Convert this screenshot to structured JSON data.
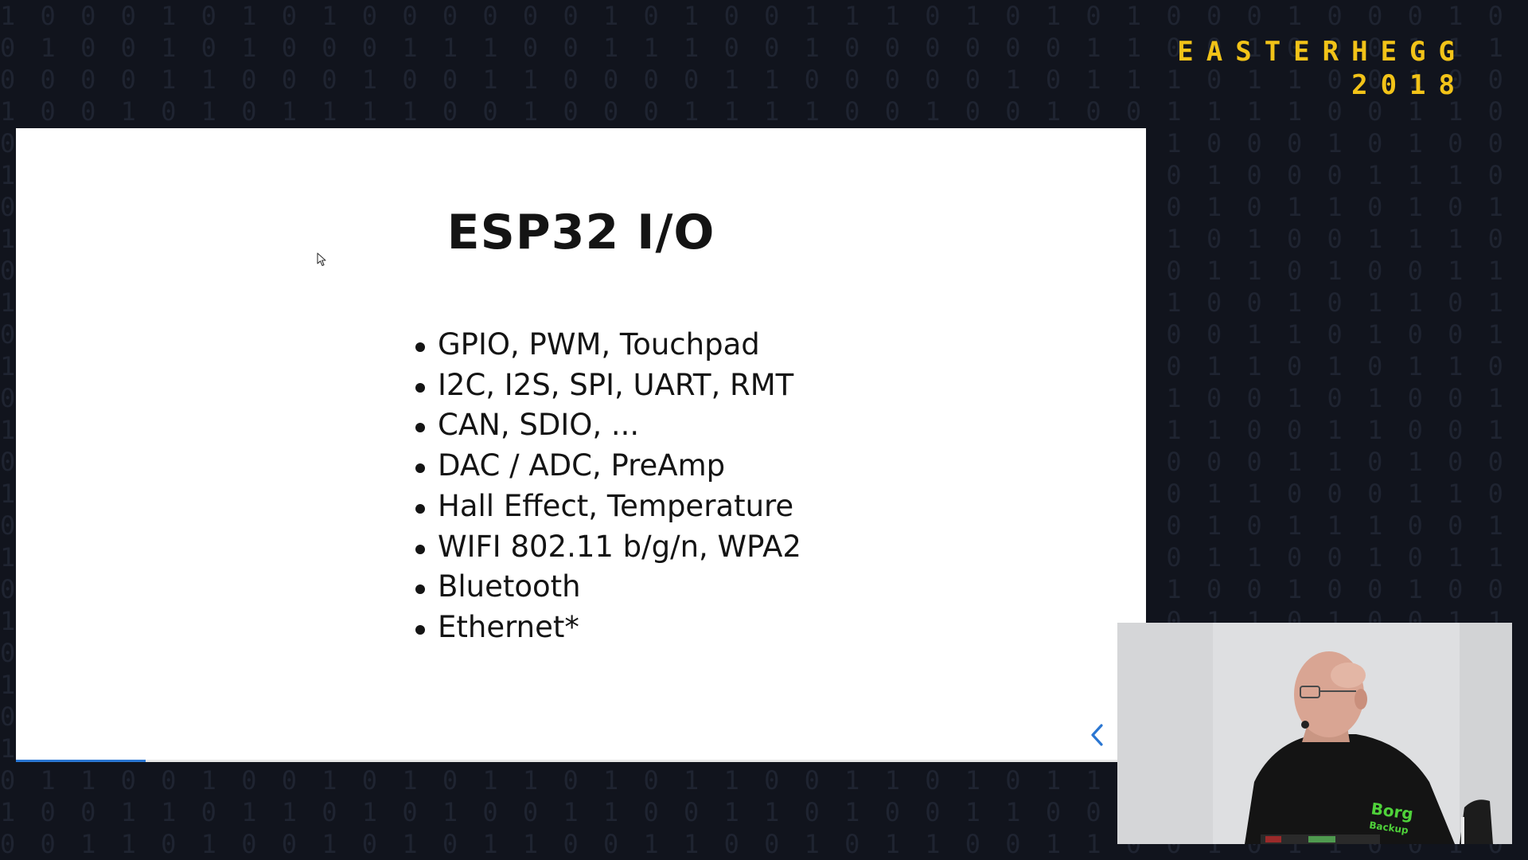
{
  "event": {
    "name": "EASTERHEGG",
    "year": "2018",
    "accent_color": "#f2c318"
  },
  "background": {
    "pattern": "binary digits",
    "rows": [
      "1 0 0 0 1 0 1 0 1 0 0 0 0 0 0 1 0 1 0 0 1 1 1 0 1 0 1 0 1 0 0 0 1 0 0 0 1 0 1 0 1 0 1 0 0 0 1 1 0 1",
      "0 1 0 0 1 0 1 0 0 0 1 1 1 0 0 1 1 1 0 0 1 0 0 0 0 0 0 1 1 0 0 1 0 0 0 1 1 1 0 1 0 1 1 0 0 1 0 0 1 1",
      "0 0 0 0 1 1 0 0 0 1 0 0 1 1 0 0 0 0 1 1 0 0 0 0 0 1 0 1 1 1 0 1 1 0 0 1 0 0 0 0 0 0 0 1 1 0 1 1 0 1",
      "1 0 0 1 0 1 0 1 1 1 1 0 0 1 0 0 0 1 1 1 1 0 0 1 0 0 1 0 0 1 1 1 1 0 0 1 1 0 0 1 0 1 0 1 1 1 0 0 0 1",
      "0 1 1 0 0 1 0 1 1 0 1 0 0 1 1 0 0 1 0 0 1 1 0 1 0 0 1 0 1 1 0 0 0 1 0 1 0 0 1 1 1 1 0 0 1 0 1 0 0 1",
      "1 1 0 1 1 0 1 0 0 0 1 1 0 1 0 1 0 0 0 1 1 0 1 0 1 1 0 0 1 0 1 0 0 0 1 1 1 0 0 1 0 1 0 0 1 1 0 0 0 1",
      "0 0 1 1 0 1 1 0 1 0 0 1 1 0 1 0 0 1 1 0 1 0 0 0 1 1 0 1 0 0 1 0 1 1 0 1 0 1 0 0 0 1 0 1 1 0 0 0 0 1",
      "1 0 1 0 0 1 0 1 0 1 1 0 0 1 1 0 1 0 1 0 0 0 0 1 0 0 0 0 1 1 0 1 0 0 1 1 1 0 0 0 1 0 0 1 0 1 1 0 0 1",
      "0 1 0 1 1 0 0 1 1 0 1 1 0 1 0 0 1 1 0 1 0 1 1 0 0 1 0 0 1 0 1 1 0 1 0 0 1 1 0 0 1 0 1 1 1 0 1 1 0 1",
      "1 1 1 0 0 1 1 0 0 1 0 0 1 0 1 1 0 0 1 0 1 1 0 1 1 0 0 1 1 1 0 0 1 0 1 1 0 1 1 1 0 0 1 1 1 0 0 1 0 1",
      "0 0 0 0 1 0 1 1 0 1 1 0 0 0 1 0 1 1 0 0 1 0 0 1 0 1 0 1 0 0 0 1 1 0 1 0 0 1 0 0 1 1 0 0 1 1 1 0 1 1",
      "1 0 0 1 1 1 0 0 1 0 1 1 0 1 1 0 0 1 1 1 0 1 0 0 1 0 1 1 0 0 1 1 0 1 0 1 1 0 0 1 0 1 1 0 0 1 1 0 0 1",
      "0 1 1 0 0 0 1 1 0 1 0 0 1 1 0 1 1 0 0 0 1 0 1 1 0 1 0 0 1 1 0 0 1 0 1 0 0 1 1 0 1 0 0 1 1 0 1 0 0 0",
      "1 0 1 0 1 0 0 1 1 0 0 1 0 0 1 1 0 0 1 0 0 1 1 0 0 1 1 0 0 1 1 0 0 1 1 0 0 1 1 0 0 1 1 0 0 1 1 0 0 1",
      "0 0 1 1 1 0 1 0 0 1 1 0 1 0 0 1 0 1 0 1 1 0 0 1 1 1 0 0 1 0 0 0 1 1 0 1 0 0 0 1 1 0 1 0 0 0 1 1 0 0",
      "1 1 0 1 0 0 1 0 1 1 0 1 0 0 1 0 1 1 0 0 1 0 1 0 0 1 0 1 1 0 1 1 0 0 0 1 1 0 1 0 0 1 0 1 1 1 0 0 1 1",
      "0 1 0 0 1 1 0 1 0 0 1 0 1 1 0 0 1 0 0 1 0 1 0 1 1 0 0 1 0 0 1 0 1 1 1 0 0 1 0 1 1 0 0 0 1 0 1 1 0 0",
      "1 0 0 1 0 1 1 0 1 0 0 1 0 0 1 1 0 1 0 0 1 1 0 0 1 1 0 1 0 0 1 1 0 0 1 0 1 1 0 1 0 0 1 1 0 0 1 0 1 0",
      "0 1 1 0 1 0 0 1 0 1 1 0 0 1 0 0 1 0 1 1 0 0 1 1 0 0 1 0 1 1 0 0 1 0 0 1 0 0 1 0 1 1 0 0 1 1 0 1 0 1",
      "1 0 0 1 0 0 1 1 0 0 1 0 1 0 1 1 0 0 1 0 1 0 0 1 0 1 0 1 0 0 1 1 0 1 0 0 1 1 0 0 1 0 1 0 0 1 1 0 1 0",
      "0 1 0 1 1 0 0 0 1 1 0 1 0 1 0 0 1 1 0 1 0 1 1 0 1 0 1 0 1 1 0 0 1 0 1 1 0 0 1 1 0 1 0 1 1 0 0 1 0 1",
      "1 0 1 1 0 1 0 1 0 0 1 1 0 0 1 0 1 0 0 1 1 0 1 0 0 1 0 1 0 1 1 0 0 1 0 1 0 1 0 0 1 1 0 1 0 0 1 0 1 1",
      "0 0 1 0 1 0 1 0 1 1 0 0 1 1 0 1 0 0 1 0 0 1 0 1 1 0 1 0 0 0 1 1 0 1 1 0 1 0 1 1 0 0 1 0 1 1 0 1 0 0",
      "1 1 0 0 1 1 0 1 0 1 0 1 0 0 1 0 1 1 0 1 1 0 0 1 0 1 0 0 1 1 0 1 0 0 1 0 1 0 0 1 0 1 0 1 0 0 1 1 0 1",
      "0 1 1 0 0 1 0 0 1 0 1 0 1 1 0 1 0 1 1 0 0 1 1 0 1 0 1 1 0 0 1 0 1 1 0 1 0 1 1 0 1 0 1 0 1 1 0 0 1 0",
      "1 0 0 1 1 0 1 1 0 1 0 1 0 0 1 1 0 0 1 1 0 1 0 0 1 1 0 0 1 1 0 1 0 0 1 1 0 1 0 0 1 1 0 1 0 1 1 0 0 1",
      "0 0 1 1 0 1 0 0 1 0 1 0 1 1 0 0 1 1 0 0 1 0 1 1 0 0 1 1 0 0 1 0 1 1 0 0 1 0 1 1 0 0 1 0 1 0 0 1 1 0",
      "1 1 0 0 1 0 1 1 0 1 0 1 0 0 1 1 0 1 0 1 0 1 0 0 1 1 0 0 1 1 0 0 1 0 1 0 1 1 0 0 1 1 0 1 0 0 1 1 0 1"
    ]
  },
  "slide": {
    "title": "ESP32  I/O",
    "bullets": [
      "GPIO, PWM, Touchpad",
      "I2C, I2S, SPI, UART, RMT",
      "CAN, SDIO, ...",
      "DAC / ADC, PreAmp",
      "Hall Effect, Temperature",
      "WIFI 802.11 b/g/n, WPA2",
      "Bluetooth",
      "Ethernet*"
    ],
    "nav": {
      "prev_icon": "chevron-left-icon"
    },
    "progress": 0.115,
    "colors": {
      "background": "#ffffff",
      "text": "#141414",
      "accent": "#2a76d2"
    }
  },
  "speaker_video": {
    "shirt_text_line1": "Borg",
    "shirt_text_line2": "Backup",
    "shirt_text_color": "#4fd23a"
  }
}
